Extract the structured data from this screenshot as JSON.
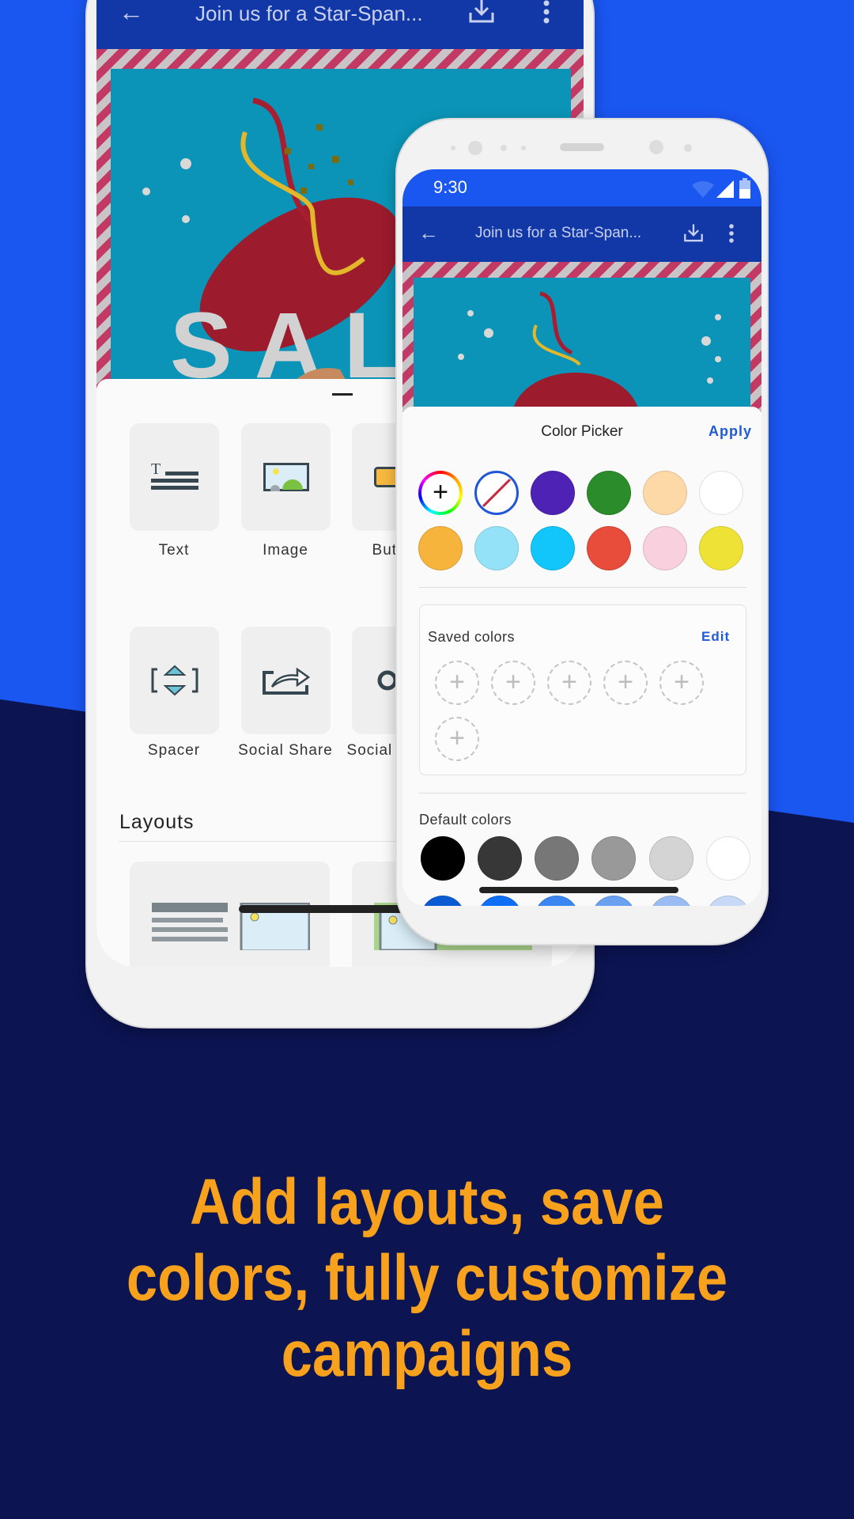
{
  "back_phone": {
    "app_bar": {
      "title": "Join us for a Star-Span...",
      "back_icon": "arrow-left-icon",
      "download_icon": "download-icon",
      "menu_icon": "more-vertical-icon"
    },
    "hero_text": "SALE",
    "content_blocks": [
      {
        "label": "Text",
        "icon": "text-block-icon"
      },
      {
        "label": "Image",
        "icon": "image-block-icon"
      },
      {
        "label": "Button",
        "icon": "button-block-icon"
      },
      {
        "label": "Spacer",
        "icon": "spacer-block-icon"
      },
      {
        "label": "Social Share",
        "icon": "social-share-icon"
      },
      {
        "label": "Social Follow",
        "icon": "social-follow-icon"
      }
    ],
    "layouts_heading": "Layouts"
  },
  "front_phone": {
    "status_bar": {
      "time": "9:30"
    },
    "app_bar": {
      "title": "Join us for a Star-Span..."
    },
    "color_picker": {
      "title": "Color Picker",
      "apply_label": "Apply",
      "palette": [
        "custom",
        "none",
        "#4e22b4",
        "#2a8c2a",
        "#fdd9a8",
        "#ffffff",
        "#f7b43c",
        "#93e2f8",
        "#12c5fb",
        "#e84c3a",
        "#f9d1de",
        "#efe236"
      ],
      "saved_colors_label": "Saved colors",
      "edit_label": "Edit",
      "saved_slots": 6,
      "default_colors_label": "Default colors",
      "default_colors": [
        "#000000",
        "#373737",
        "#777777",
        "#999999",
        "#d4d4d4",
        "#ffffff"
      ],
      "default_colors_row2": [
        "#0a5bd3",
        "#0e6ef5",
        "#3b86f0",
        "#6aa0f0",
        "#9bbcf3",
        "#c8d9f7"
      ]
    }
  },
  "caption": [
    "Add layouts, save",
    "colors, fully customize",
    "campaigns"
  ],
  "colors": {
    "accent_blue": "#1a56f0",
    "navy": "#0c1452",
    "caption_orange": "#f7a11d",
    "link_blue": "#1f5bd6"
  }
}
